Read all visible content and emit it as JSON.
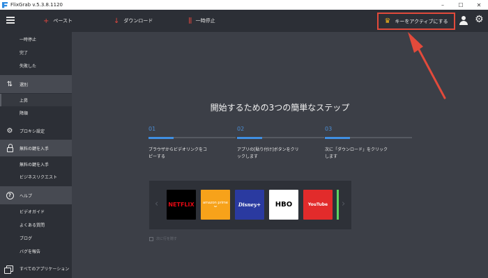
{
  "window": {
    "title": "FlixGrab  v.5.3.8.1120",
    "controls": [
      "–",
      "☐",
      "✕"
    ]
  },
  "toolbar": {
    "paste_label": "ペースト",
    "download_label": "ダウンロード",
    "pause_label": "一時停止",
    "activate_key_label": "キーをアクティブにする"
  },
  "sidebar": {
    "items": [
      {
        "label": "一時停止"
      },
      {
        "label": "完了"
      },
      {
        "label": "失敗した"
      },
      {
        "label": "選別"
      },
      {
        "label": "上昇"
      },
      {
        "label": "降順"
      },
      {
        "label": "プロキシ設定"
      },
      {
        "label": "無料の鍵を入手"
      },
      {
        "label": "無料の鍵を入手"
      },
      {
        "label": "ビジネスリクエスト"
      },
      {
        "label": "ヘルプ"
      },
      {
        "label": "ビデオガイド"
      },
      {
        "label": "よくある質問"
      },
      {
        "label": "ブログ"
      },
      {
        "label": "バグを報告"
      },
      {
        "label": "すべてのアプリケーション"
      }
    ]
  },
  "main": {
    "title": "開始するための3つの簡単なステップ",
    "steps": [
      {
        "num": "01",
        "text": "ブラウザからビデオリンクをコピーする"
      },
      {
        "num": "02",
        "text": "アプリの[貼り付け]ボタンをクリックします"
      },
      {
        "num": "03",
        "text": "次に「ダウンロード」をクリックします"
      }
    ],
    "platforms": [
      {
        "name": "NETFLIX"
      },
      {
        "name": "amazon prime"
      },
      {
        "name": "Disney+"
      },
      {
        "name": "HBO"
      },
      {
        "name": "YouTube"
      }
    ],
    "checkbox_label": "次に行を隠す"
  },
  "colors": {
    "accent_red": "#e3473f",
    "annotation_red": "#e24a3b",
    "step_blue": "#3f8fe3",
    "crown_gold": "#f1b31c"
  },
  "icons": {
    "paste": "plus-icon",
    "download": "arrow-down-icon",
    "pause": "pause-icon",
    "crown": "crown-icon",
    "user": "user-icon",
    "settings": "gear-icon"
  }
}
